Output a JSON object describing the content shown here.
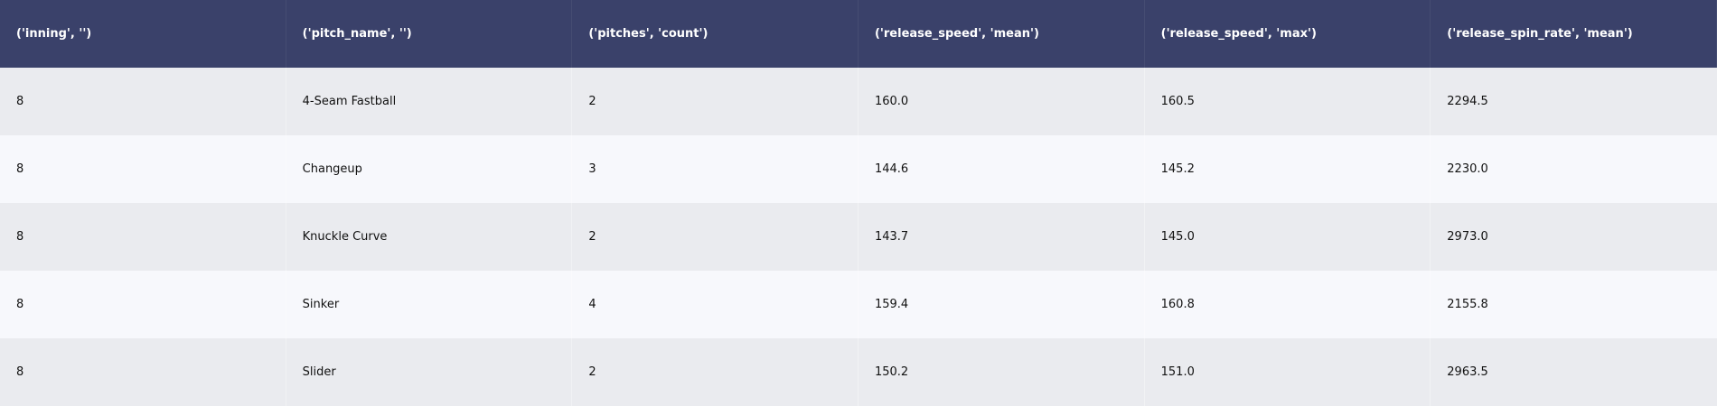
{
  "chart_data": {
    "type": "table",
    "columns": [
      "('inning', '')",
      "('pitch_name', '')",
      "('pitches', 'count')",
      "('release_speed', 'mean')",
      "('release_speed', 'max')",
      "('release_spin_rate', 'mean')"
    ],
    "rows": [
      [
        "8",
        "4-Seam Fastball",
        "2",
        "160.0",
        "160.5",
        "2294.5"
      ],
      [
        "8",
        "Changeup",
        "3",
        "144.6",
        "145.2",
        "2230.0"
      ],
      [
        "8",
        "Knuckle Curve",
        "2",
        "143.7",
        "145.0",
        "2973.0"
      ],
      [
        "8",
        "Sinker",
        "4",
        "159.4",
        "160.8",
        "2155.8"
      ],
      [
        "8",
        "Slider",
        "2",
        "150.2",
        "151.0",
        "2963.5"
      ]
    ]
  },
  "colors": {
    "header_bg": "#3a416a",
    "header_text": "#ffffff",
    "row_odd_bg": "#eaebef",
    "row_even_bg": "#f7f8fc",
    "body_text": "#111111"
  }
}
